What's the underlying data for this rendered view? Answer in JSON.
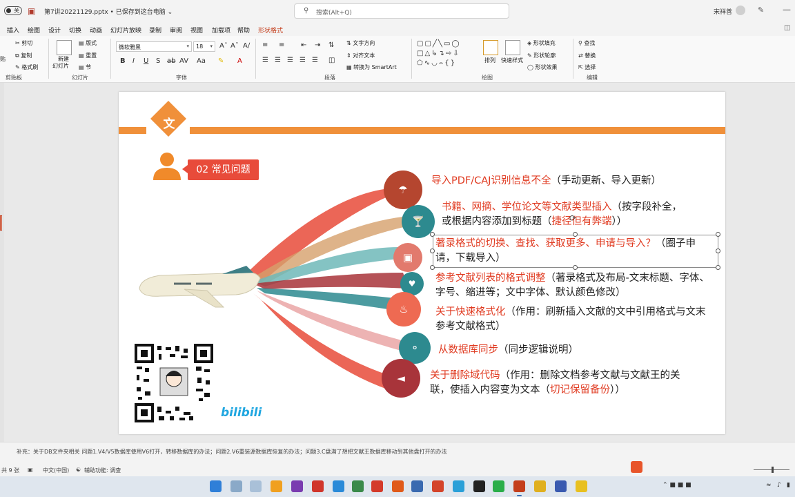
{
  "titlebar": {
    "autosave": "关",
    "doc_title": "第7讲20221129.pptx • 已保存到这台电脑 ⌄",
    "search_placeholder": "搜索(Alt+Q)",
    "user": "宋祥善"
  },
  "menu": {
    "tabs": [
      "插入",
      "绘图",
      "设计",
      "切换",
      "动画",
      "幻灯片放映",
      "录制",
      "审阅",
      "视图",
      "加载项",
      "帮助",
      "形状格式"
    ],
    "active": "形状格式"
  },
  "ribbon": {
    "clipboard": {
      "cut": "剪切",
      "copy": "复制",
      "format_painter": "格式刷",
      "paste": "贴",
      "group": "剪贴板"
    },
    "slides": {
      "new_slide": "新建",
      "new_slide2": "幻灯片",
      "layout": "版式",
      "reset": "重置",
      "section": "节",
      "group": "幻灯片"
    },
    "font": {
      "name": "微软雅黑",
      "size": "18",
      "group": "字体"
    },
    "paragraph": {
      "text_direction": "文字方向",
      "align_text": "对齐文本",
      "smartart": "转换为 SmartArt",
      "group": "段落"
    },
    "drawing": {
      "arrange": "排列",
      "quick_styles": "快速样式",
      "fill": "形状填充",
      "outline": "形状轮廓",
      "effects": "形状效果",
      "group": "绘图"
    },
    "editing": {
      "find": "查找",
      "replace": "替换",
      "select": "选择",
      "group": "编辑"
    }
  },
  "slide": {
    "badge": "文",
    "section_tag": "02 常见问题",
    "items": [
      {
        "red": "导入PDF/CAJ识别信息不全",
        "rest": "（手动更新、导入更新）"
      },
      {
        "red": "书籍、网摘、学位论文等文献类型插入",
        "rest": "（按字段补全，或根据内容添加到标题（",
        "red2": "捷径但有弊端",
        "rest2": "））"
      },
      {
        "red": "著录格式的切换、查找、获取更多、申请与导入？",
        "rest": "（圈子申请，下载导入）"
      },
      {
        "red": "参考文献列表的格式调整",
        "rest": "（著录格式及布局-文末标题、字体、字号、缩进等；文中字体、默认颜色修改）"
      },
      {
        "red": "关于快速格式化",
        "rest": "（作用：刷新插入文献的文中引用格式与文末参考文献格式）"
      },
      {
        "red": "从数据库同步",
        "rest": "（同步逻辑说明）"
      },
      {
        "red": "关于删除域代码",
        "rest": "（作用：删除文档参考文献与文献王的关联，使插入内容变为文本（",
        "red2": "切记保留备份",
        "rest2": "））"
      }
    ],
    "brand": "bilibili"
  },
  "notes": "补充：关于DB文件夹相关 问题1.V4/V5数据库使用V6打开，转移数据库的办法；问题2.V6重装源数据库恢复的办法；问题3.C盘满了想把文献王数据库移动到其他盘打开的办法",
  "status": {
    "slides": "共 9 张",
    "lang": "中文(中国)",
    "accessibility": "辅助功能: 调查"
  },
  "colors": {
    "accent": "#c43e1c",
    "orange": "#f0903a",
    "red": "#e84b3a",
    "teal": "#2d8a8f"
  }
}
